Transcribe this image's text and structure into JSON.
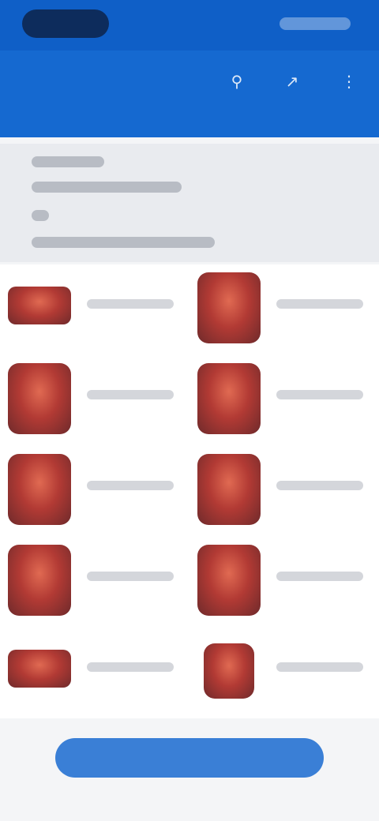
{
  "app": {
    "title": "",
    "icons": [
      "search-icon",
      "share-icon",
      "more-icon"
    ],
    "tabs": [
      "",
      "",
      "",
      ""
    ]
  },
  "filters": {
    "lines": [
      "",
      "",
      "",
      ""
    ]
  },
  "grid": {
    "items": [
      {
        "title": ""
      },
      {
        "title": ""
      },
      {
        "title": ""
      },
      {
        "title": ""
      },
      {
        "title": ""
      },
      {
        "title": ""
      },
      {
        "title": ""
      },
      {
        "title": ""
      },
      {
        "title": ""
      },
      {
        "title": ""
      }
    ]
  },
  "cta": {
    "label": ""
  },
  "colors": {
    "primary": "#1569d0",
    "status": "#0f5fc7",
    "cta": "#3a7fd6",
    "thumb": "#b23a34"
  }
}
